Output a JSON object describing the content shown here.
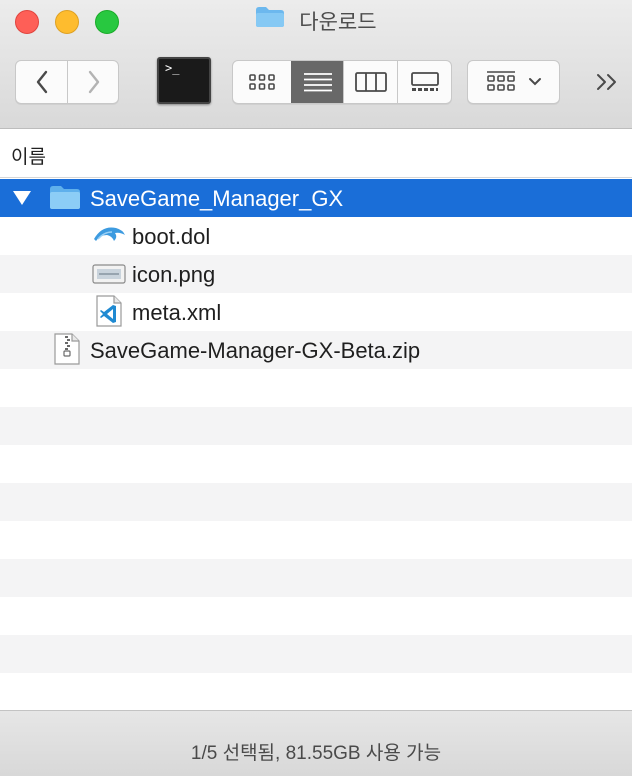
{
  "window": {
    "title": "다운로드",
    "title_icon": "folder-icon"
  },
  "toolbar": {
    "back_icon": "chevron-left-icon",
    "forward_icon": "chevron-right-icon",
    "terminal_prompt": ">_",
    "view_modes": [
      "icon-view",
      "list-view",
      "column-view",
      "gallery-view"
    ],
    "selected_view": "list-view",
    "group_icon": "group-by-icon",
    "more_icon": "double-chevron-right-icon"
  },
  "columns": {
    "name_header": "이름"
  },
  "files": [
    {
      "name": "SaveGame_Manager_GX",
      "type": "folder",
      "expanded": true,
      "selected": true,
      "icon": "folder-icon"
    },
    {
      "name": "boot.dol",
      "type": "file",
      "indent": 1,
      "icon": "dolphin-icon"
    },
    {
      "name": "icon.png",
      "type": "file",
      "indent": 1,
      "icon": "image-file-icon"
    },
    {
      "name": "meta.xml",
      "type": "file",
      "indent": 1,
      "icon": "vscode-file-icon"
    },
    {
      "name": "SaveGame-Manager-GX-Beta.zip",
      "type": "archive",
      "icon": "zip-file-icon"
    }
  ],
  "status": {
    "text": "1/5 선택됨, 81.55GB 사용 가능"
  },
  "colors": {
    "selection": "#1a6ed8",
    "folder": "#6cb8ee",
    "close": "#fe5f57",
    "minimize": "#febc2e",
    "maximize": "#28c840"
  }
}
